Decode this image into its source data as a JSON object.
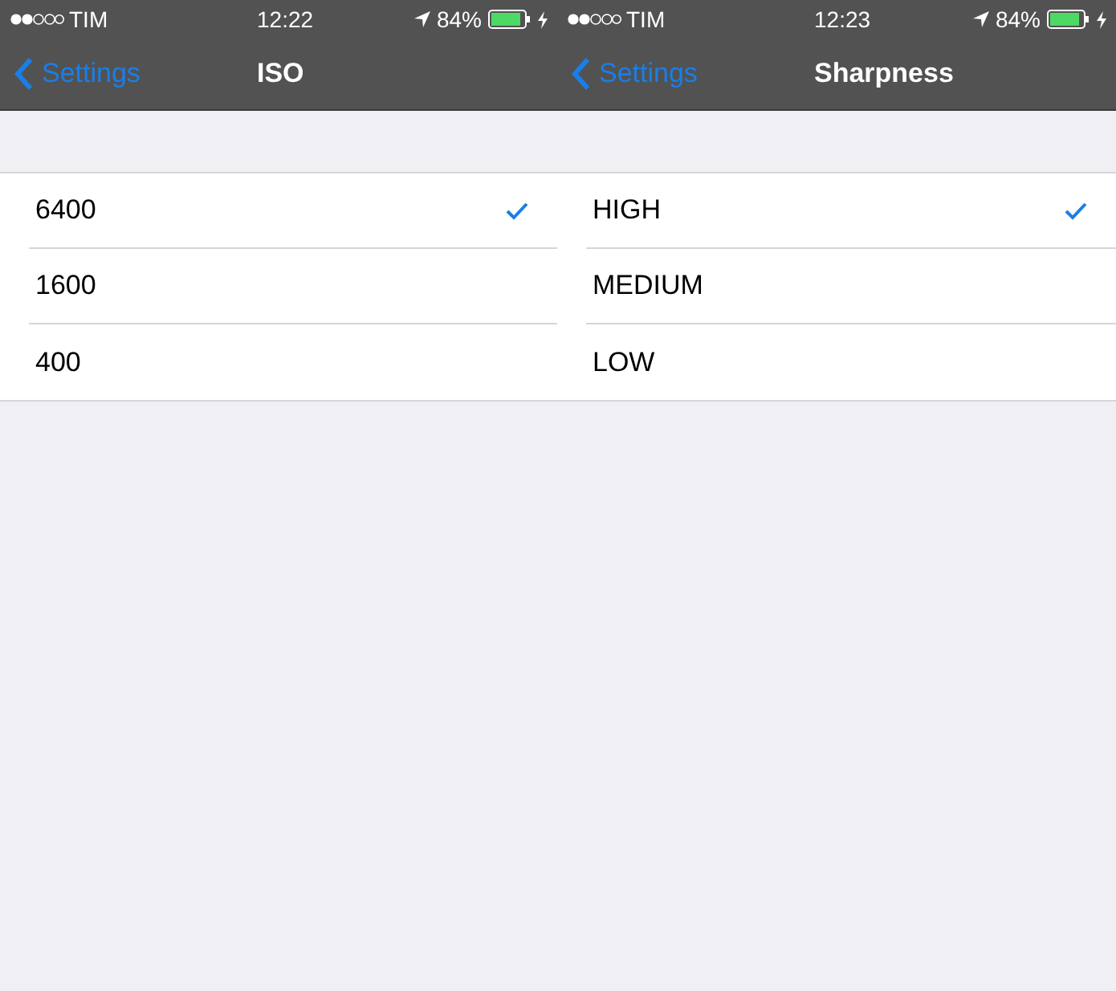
{
  "screens": [
    {
      "status_bar": {
        "carrier": "TIM",
        "time": "12:22",
        "battery": "84%"
      },
      "nav": {
        "back": "Settings",
        "title": "ISO"
      },
      "options": [
        {
          "label": "6400",
          "selected": true
        },
        {
          "label": "1600",
          "selected": false
        },
        {
          "label": "400",
          "selected": false
        }
      ]
    },
    {
      "status_bar": {
        "carrier": "TIM",
        "time": "12:23",
        "battery": "84%"
      },
      "nav": {
        "back": "Settings",
        "title": "Sharpness"
      },
      "options": [
        {
          "label": "HIGH",
          "selected": true
        },
        {
          "label": "MEDIUM",
          "selected": false
        },
        {
          "label": "LOW",
          "selected": false
        }
      ]
    }
  ]
}
